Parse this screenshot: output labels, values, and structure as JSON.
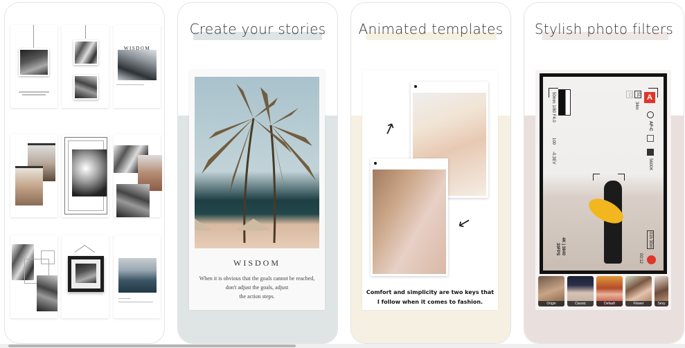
{
  "screenshots": [
    {
      "caption": "",
      "band_color": "#ffffff"
    },
    {
      "caption": "Create your stories",
      "band_color": "#dfe5e5",
      "highlight_color": "#dfe5e5",
      "template": {
        "title": "WISDOM",
        "quote_lines": [
          "When it is obvious that the goals cannot be reached,",
          "don't adjust the goals, adjust",
          "the action steps."
        ]
      }
    },
    {
      "caption": "Animated templates",
      "band_color": "#f5f0e1",
      "highlight_color": "#f5f0e1",
      "template": {
        "quote_lines": [
          "Comfort and simplicity are two keys that",
          "I follow when it comes to fashion."
        ]
      }
    },
    {
      "caption": "Stylish photo filters",
      "band_color": "#e9dfdc",
      "highlight_color": "#efe7e4",
      "camera_hud": {
        "lens": "50mm 1/80 F4.0",
        "slot1": "S1",
        "slot1_value": "34m",
        "slot2": "S2",
        "mode_badge": "A",
        "focus": "AF-C",
        "white_balance": "5600K",
        "iso": "100",
        "exposure": "-0.3EV",
        "battery": "01h 30m",
        "timecode": "00:12",
        "video": "4K | 3840",
        "fps": "30FPS"
      },
      "filters": [
        {
          "label": "Origin"
        },
        {
          "label": "Classic"
        },
        {
          "label": "Default"
        },
        {
          "label": "Flower"
        },
        {
          "label": "Sexy"
        }
      ]
    }
  ],
  "card1": {
    "wisdom_label": "WISDOM"
  },
  "scrollbar": {
    "position_fraction": 0.0,
    "visible_fraction": 0.43
  }
}
